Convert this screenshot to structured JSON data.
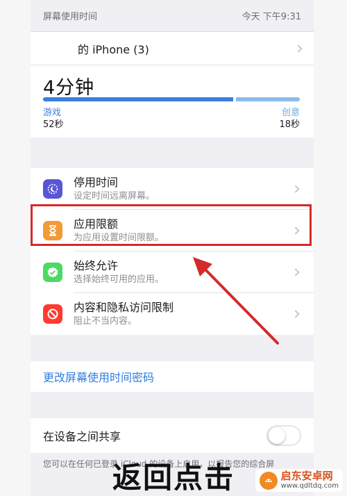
{
  "header": {
    "left": "屏幕使用时间",
    "right": "今天 下午9:31"
  },
  "device": {
    "label": "的 iPhone (3)"
  },
  "usage": {
    "total": "4分钟",
    "bar_split": {
      "game_fraction": 0.74
    },
    "categories": [
      {
        "name": "游戏",
        "value": "52秒",
        "color": "#3b7ee0"
      },
      {
        "name": "创意",
        "value": "18秒",
        "color": "#8cbbe9"
      }
    ]
  },
  "menu": [
    {
      "title": "停用时间",
      "subtitle": "设定时间远离屏幕。",
      "icon": "downtime-moon-icon",
      "icon_color": "#5856d6"
    },
    {
      "title": "应用限额",
      "subtitle": "为应用设置时间限额。",
      "icon": "hourglass-icon",
      "icon_color": "#f29a38"
    },
    {
      "title": "始终允许",
      "subtitle": "选择始终可用的应用。",
      "icon": "checkmark-badge-icon",
      "icon_color": "#4cd964"
    },
    {
      "title": "内容和隐私访问限制",
      "subtitle": "阻止不当内容。",
      "icon": "restriction-icon",
      "icon_color": "#ff3b30"
    }
  ],
  "change_passcode": "更改屏幕使用时间密码",
  "share": {
    "label": "在设备之间共享",
    "enabled": false
  },
  "footnote": "您可以在任何已登录 iCloud 的设备上启用，以报告您的综合屏",
  "caption": "返回点击",
  "watermark": {
    "name": "启东安卓网",
    "url": "www.qdltdq.com"
  },
  "colors": {
    "accent": "#2f7de0",
    "highlight": "#d42a2a"
  }
}
